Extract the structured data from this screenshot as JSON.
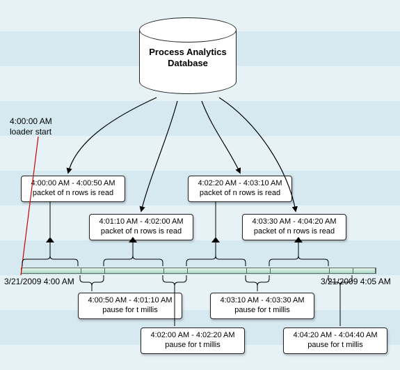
{
  "chart_data": {
    "type": "timeline",
    "title": "Process Analytics Database",
    "loader_start_time": "4:00:00 AM",
    "date": "3/21/2009",
    "time_range": [
      "4:00 AM",
      "4:05 AM"
    ],
    "events": [
      {
        "kind": "read",
        "start": "4:00:00 AM",
        "end": "4:00:50 AM",
        "desc": "packet of n rows is read"
      },
      {
        "kind": "pause",
        "start": "4:00:50 AM",
        "end": "4:01:10 AM",
        "desc": "pause for t millis"
      },
      {
        "kind": "read",
        "start": "4:01:10 AM",
        "end": "4:02:00 AM",
        "desc": "packet of n rows is read"
      },
      {
        "kind": "pause",
        "start": "4:02:00 AM",
        "end": "4:02:20 AM",
        "desc": "pause for t millis"
      },
      {
        "kind": "read",
        "start": "4:02:20 AM",
        "end": "4:03:10 AM",
        "desc": "packet of n rows is read"
      },
      {
        "kind": "pause",
        "start": "4:03:10 AM",
        "end": "4:03:30 AM",
        "desc": "pause for t millis"
      },
      {
        "kind": "read",
        "start": "4:03:30 AM",
        "end": "4:04:20 AM",
        "desc": "packet of n rows is read"
      },
      {
        "kind": "pause",
        "start": "4:04:20 AM",
        "end": "4:04:40 AM",
        "desc": "pause for t millis"
      }
    ]
  },
  "db_title_l1": "Process Analytics",
  "db_title_l2": "Database",
  "loader_label_l1": "4:00:00 AM",
  "loader_label_l2": "loader start",
  "tl_start": "3/21/2009 4:00 AM",
  "tl_end": "3/21/2009 4:05 AM",
  "box_r1_l1": "4:00:00 AM - 4:00:50 AM",
  "box_r1_l2": "packet of n rows is read",
  "box_r2_l1": "4:01:10 AM - 4:02:00 AM",
  "box_r2_l2": "packet of n rows is read",
  "box_r3_l1": "4:02:20 AM - 4:03:10 AM",
  "box_r3_l2": "packet of n rows is read",
  "box_r4_l1": "4:03:30 AM - 4:04:20 AM",
  "box_r4_l2": "packet of n rows is read",
  "box_p1_l1": "4:00:50 AM - 4:01:10 AM",
  "box_p1_l2": "pause for t millis",
  "box_p2_l1": "4:02:00 AM - 4:02:20 AM",
  "box_p2_l2": "pause for t millis",
  "box_p3_l1": "4:03:10 AM - 4:03:30 AM",
  "box_p3_l2": "pause for t millis",
  "box_p4_l1": "4:04:20 AM - 4:04:40 AM",
  "box_p4_l2": "pause for t millis"
}
